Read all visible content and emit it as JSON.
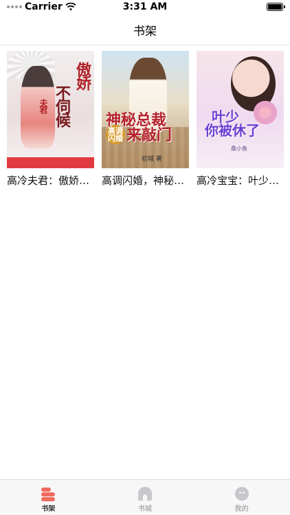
{
  "status_bar": {
    "carrier": "Carrier",
    "time": "3:31 AM",
    "battery_level": 1.0
  },
  "nav": {
    "title": "书架"
  },
  "books": [
    {
      "title": "高冷夫君：傲娇不伺候",
      "cover_text": [
        "傲娇",
        "不伺候",
        "夫君"
      ]
    },
    {
      "title": "高调闪婚，神秘总裁来敲门",
      "cover_text": [
        "神秘总裁",
        "来敲门",
        "高调闪婚",
        "初城 著"
      ]
    },
    {
      "title": "高冷宝宝：叶少，你被休了",
      "cover_text": [
        "叶少",
        "你被休了",
        "桑小鱼"
      ]
    }
  ],
  "tabs": [
    {
      "label": "书架",
      "active": true,
      "icon": "bookshelf-icon"
    },
    {
      "label": "书城",
      "active": false,
      "icon": "bookstore-icon"
    },
    {
      "label": "我的",
      "active": false,
      "icon": "profile-icon"
    }
  ],
  "colors": {
    "accent": "#f06a5e",
    "tab_inactive": "#c7c7cc",
    "cover_red": "#e23a42"
  }
}
